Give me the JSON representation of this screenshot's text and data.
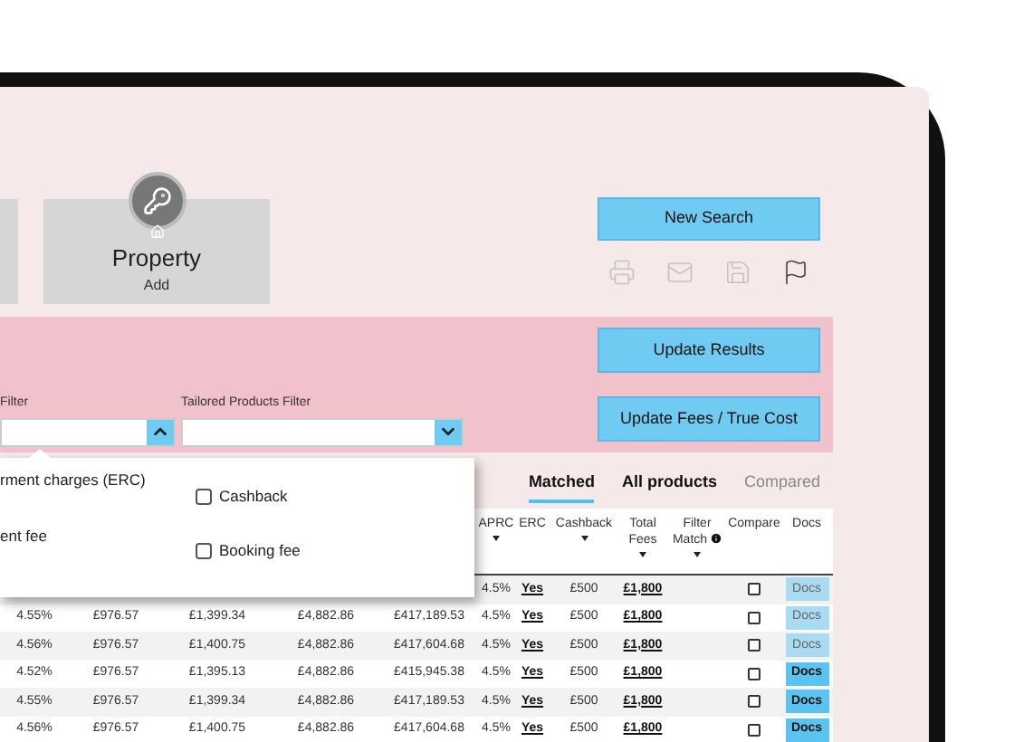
{
  "cards": [
    {
      "title": "Property",
      "subtitle": "Add"
    }
  ],
  "new_search": "New Search",
  "toolbar_icons": [
    {
      "disabled": true
    },
    {
      "disabled": true
    },
    {
      "disabled": true
    },
    {
      "disabled": false
    }
  ],
  "filters": [
    {
      "label": "Filter",
      "expanded": true
    },
    {
      "label": "Tailored Products Filter",
      "expanded": false
    }
  ],
  "update_buttons": [
    "Update Results",
    "Update Fees / True Cost"
  ],
  "filter_options": [
    {
      "kind": "text",
      "label": "rment charges (ERC)"
    },
    {
      "kind": "checkbox",
      "label": "Cashback",
      "checked": false
    },
    {
      "kind": "text",
      "label": "ent fee"
    },
    {
      "kind": "checkbox",
      "label": "Booking fee",
      "checked": false
    }
  ],
  "tabs": [
    {
      "label": "Matched",
      "selected": true,
      "disabled": false
    },
    {
      "label": "All products",
      "selected": false,
      "disabled": false
    },
    {
      "label": "Compared",
      "selected": false,
      "disabled": true
    }
  ],
  "table": {
    "columns": [
      {
        "label": "APRC",
        "sortable": true,
        "info": false
      },
      {
        "label": "ERC",
        "sortable": false,
        "info": false
      },
      {
        "label": "Cashback",
        "sortable": true,
        "info": false
      },
      {
        "label": "Total Fees",
        "sortable": true,
        "info": false
      },
      {
        "label": "Filter Match",
        "sortable": true,
        "info": true
      },
      {
        "label": "Compare",
        "sortable": false,
        "info": false
      },
      {
        "label": "Docs",
        "sortable": false,
        "info": false
      }
    ],
    "rows": [
      {
        "aprc": "4.5%",
        "erc": "Yes",
        "cashback": "£500",
        "total_fees": "£1,800",
        "compare": false,
        "docs": "Docs",
        "docs_active": false
      },
      {
        "rate": "4.55%",
        "column_2": "£976.57",
        "column_3": "£1,399.34",
        "column_4": "£4,882.86",
        "column_5": "£417,189.53",
        "aprc": "4.5%",
        "erc": "Yes",
        "cashback": "£500",
        "total_fees": "£1,800",
        "compare": false,
        "docs": "Docs",
        "docs_active": false
      },
      {
        "rate": "4.56%",
        "column_2": "£976.57",
        "column_3": "£1,400.75",
        "column_4": "£4,882.86",
        "column_5": "£417,604.68",
        "aprc": "4.5%",
        "erc": "Yes",
        "cashback": "£500",
        "total_fees": "£1,800",
        "compare": false,
        "docs": "Docs",
        "docs_active": false
      },
      {
        "rate": "4.52%",
        "column_2": "£976.57",
        "column_3": "£1,395.13",
        "column_4": "£4,882.86",
        "column_5": "£415,945.38",
        "aprc": "4.5%",
        "erc": "Yes",
        "cashback": "£500",
        "total_fees": "£1,800",
        "compare": false,
        "docs": "Docs",
        "docs_active": true
      },
      {
        "rate": "4.55%",
        "column_2": "£976.57",
        "column_3": "£1,399.34",
        "column_4": "£4,882.86",
        "column_5": "£417,189.53",
        "aprc": "4.5%",
        "erc": "Yes",
        "cashback": "£500",
        "total_fees": "£1,800",
        "compare": false,
        "docs": "Docs",
        "docs_active": true
      },
      {
        "rate": "4.56%",
        "column_2": "£976.57",
        "column_3": "£1,400.75",
        "column_4": "£4,882.86",
        "column_5": "£417,604.68",
        "aprc": "4.5%",
        "erc": "Yes",
        "cashback": "£500",
        "total_fees": "£1,800",
        "compare": false,
        "docs": "Docs",
        "docs_active": true
      }
    ]
  }
}
